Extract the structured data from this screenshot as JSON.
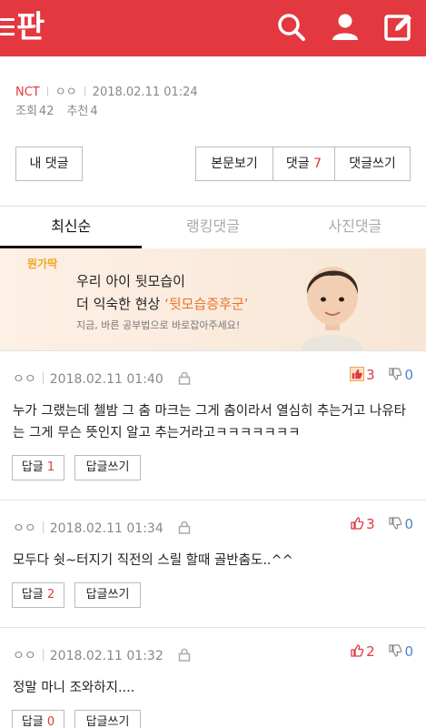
{
  "header": {
    "logo_text": "판",
    "icons": [
      "menu-icon",
      "search-icon",
      "user-icon",
      "write-icon"
    ],
    "brand_color": "#e3383f"
  },
  "post_meta": {
    "category": "NCT",
    "author": "ㅇㅇ",
    "datetime": "2018.02.11 01:24",
    "views_label": "조회",
    "views": "42",
    "recommend_label": "추천",
    "recommend": "4"
  },
  "actions": {
    "my_comments": "내 댓글",
    "view_post": "본문보기",
    "comments_label": "댓글",
    "comments_count": "7",
    "write_comment": "댓글쓰기"
  },
  "tabs": [
    {
      "label": "최신순",
      "active": true
    },
    {
      "label": "랭킹댓글",
      "active": false
    },
    {
      "label": "사진댓글",
      "active": false
    }
  ],
  "banner": {
    "logo": "뭔가딱",
    "line1": "우리 아이 뒷모습이",
    "line2_prefix": "더 익숙한 현상 ",
    "line2_highlight": "‘뒷모습증후군’",
    "line3": "지금, 바른 공부법으로 바로잡아주세요!"
  },
  "comments": [
    {
      "author": "ㅇㅇ",
      "datetime": "2018.02.11 01:40",
      "likes": "3",
      "dislikes": "0",
      "text": "누가 그랬는데 첼밤 그 춤 마크는 그게 춤이라서 열심히 추는거고 나유타는 그게 무슨 뜻인지 알고 추는거라고ㅋㅋㅋㅋㅋㅋㅋ",
      "reply_label": "답글",
      "reply_count": "1",
      "write_reply": "답글쓰기"
    },
    {
      "author": "ㅇㅇ",
      "datetime": "2018.02.11 01:34",
      "likes": "3",
      "dislikes": "0",
      "text": "모두다 쉿~터지기 직전의 스릴 할때 골반춤도..^^",
      "reply_label": "답글",
      "reply_count": "2",
      "write_reply": "답글쓰기"
    },
    {
      "author": "ㅇㅇ",
      "datetime": "2018.02.11 01:32",
      "likes": "2",
      "dislikes": "0",
      "text": "정말 마니 조와하지....",
      "reply_label": "답글",
      "reply_count": "0",
      "write_reply": "답글쓰기"
    }
  ]
}
